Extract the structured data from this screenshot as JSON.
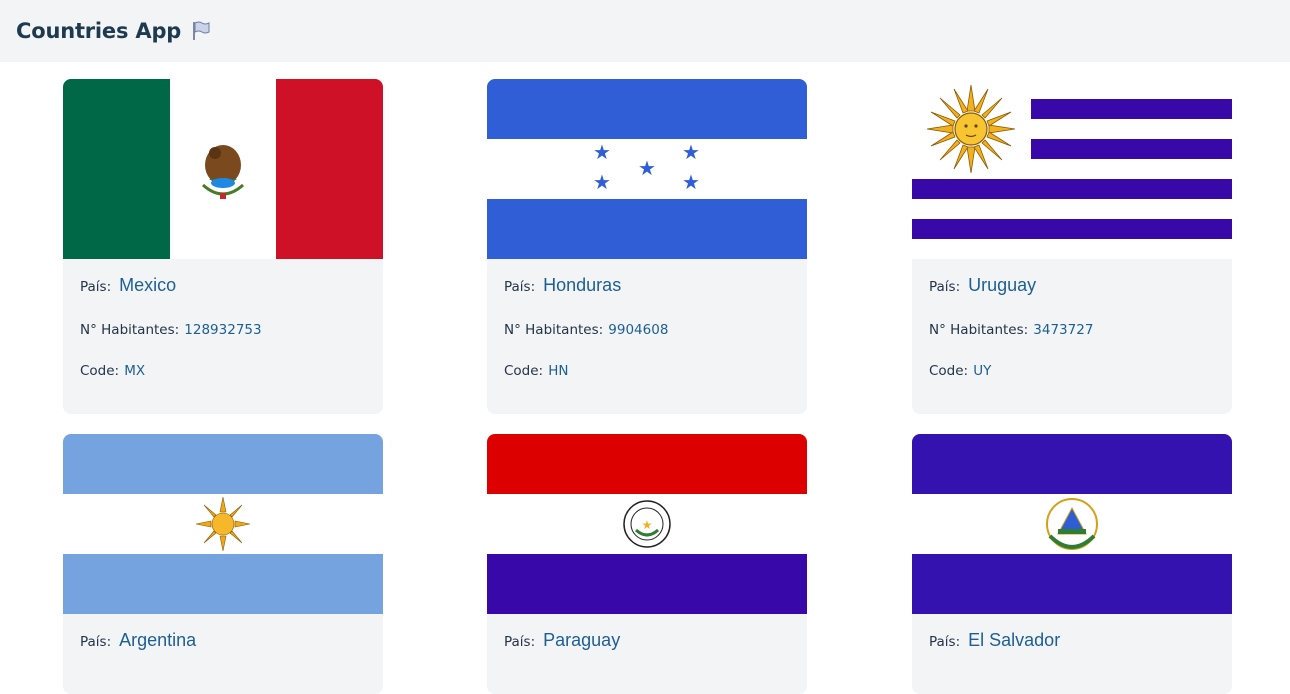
{
  "app": {
    "title": "Countries App",
    "icon": "flag-icon"
  },
  "labels": {
    "country": "País:",
    "inhabitants": "N° Habitantes:",
    "code": "Code:"
  },
  "countries": [
    {
      "name": "Mexico",
      "population": "128932753",
      "code": "MX"
    },
    {
      "name": "Honduras",
      "population": "9904608",
      "code": "HN"
    },
    {
      "name": "Uruguay",
      "population": "3473727",
      "code": "UY"
    },
    {
      "name": "Argentina"
    },
    {
      "name": "Paraguay"
    },
    {
      "name": "El Salvador"
    }
  ],
  "colors": {
    "navbar_bg": "#f3f4f6",
    "card_bg": "#f3f4f6",
    "value_text": "#1d5f94",
    "brand_text": "#1e3a4e"
  }
}
